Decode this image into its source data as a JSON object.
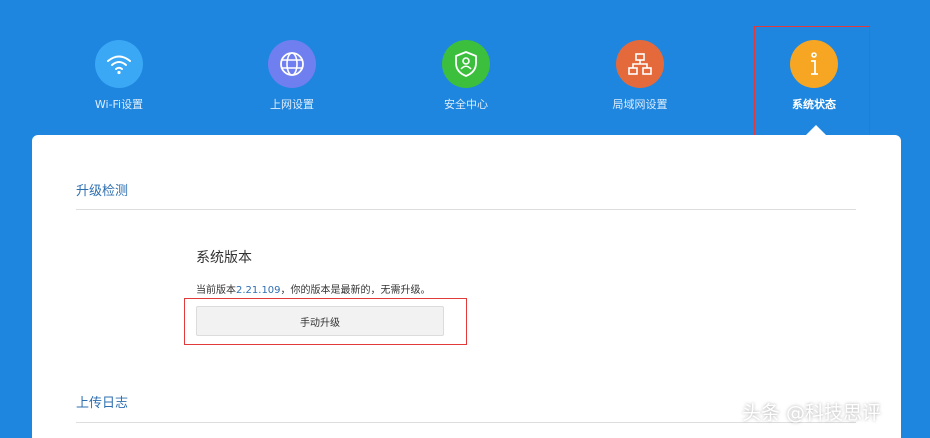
{
  "nav": {
    "items": [
      {
        "label": "Wi-Fi设置",
        "icon": "wifi-icon",
        "color": "#3aa8f4"
      },
      {
        "label": "上网设置",
        "icon": "globe-icon",
        "color": "#6f7ff0"
      },
      {
        "label": "安全中心",
        "icon": "shield-icon",
        "color": "#3cbf3c"
      },
      {
        "label": "局域网设置",
        "icon": "network-icon",
        "color": "#e46a3c"
      },
      {
        "label": "系统状态",
        "icon": "info-icon",
        "color": "#f6a623",
        "active": true
      }
    ]
  },
  "upgrade": {
    "section_title": "升级检测",
    "version_title": "系统版本",
    "current_prefix": "当前版本",
    "version": "2.21.109",
    "current_suffix": "，你的版本是最新的，无需升级。",
    "button_label": "手动升级"
  },
  "log": {
    "section_title": "上传日志"
  },
  "watermark": "头条 @科技思评",
  "colors": {
    "background": "#1f86e0",
    "accent": "#2e6fb0",
    "highlight": "#e23a3a"
  }
}
